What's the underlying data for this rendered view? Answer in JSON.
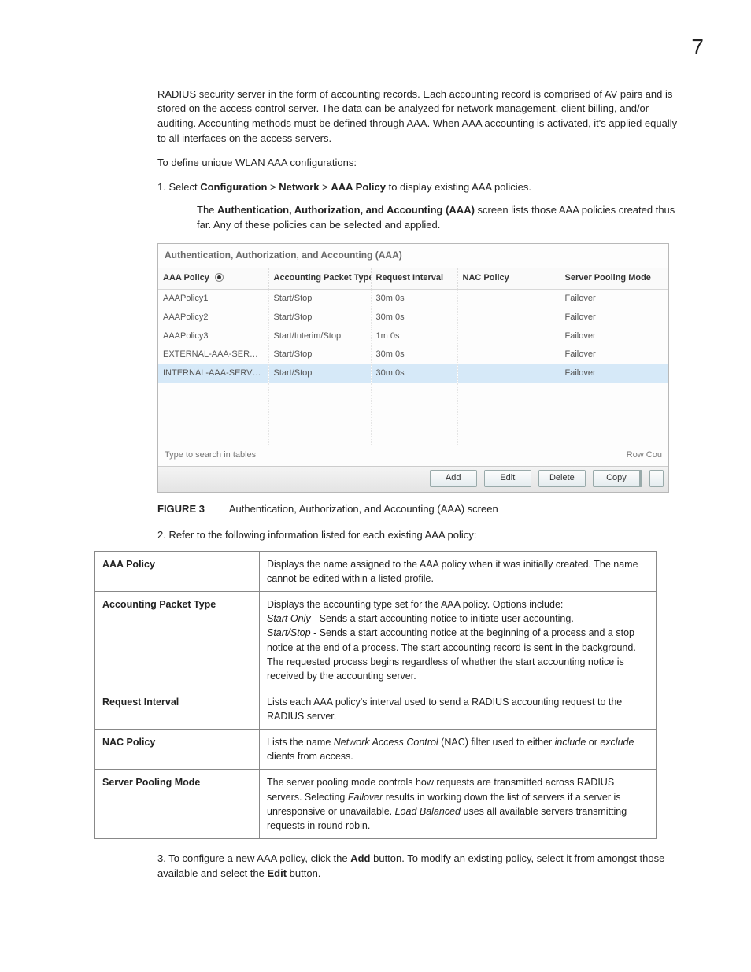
{
  "page_number": "7",
  "intro_para": "RADIUS security server in the form of accounting records. Each accounting record is comprised of AV pairs and is stored on the access control server. The data can be analyzed for network management, client billing, and/or auditing. Accounting methods must be defined through AAA. When AAA accounting is activated, it's applied equally to all interfaces on the access servers.",
  "define_line": "To define unique WLAN AAA configurations:",
  "step1_prefix": "1.   Select ",
  "step1_conf": "Configuration",
  "step1_gt1": " > ",
  "step1_net": "Network",
  "step1_gt2": " > ",
  "step1_aaa": "AAA Policy",
  "step1_suffix": " to display existing AAA policies.",
  "step1_sub_a": "The ",
  "step1_sub_bold": "Authentication, Authorization, and Accounting (AAA)",
  "step1_sub_b": " screen lists those AAA policies created thus far. Any of these policies can be selected and applied.",
  "shot": {
    "title": "Authentication, Authorization, and Accounting (AAA)",
    "headers": [
      "AAA Policy",
      "Accounting Packet Type",
      "Request Interval",
      "NAC Policy",
      "Server Pooling Mode"
    ],
    "rows": [
      {
        "policy": "AAAPolicy1",
        "pkt": "Start/Stop",
        "req": "30m 0s",
        "nac": "",
        "pool": "Failover",
        "selected": false
      },
      {
        "policy": "AAAPolicy2",
        "pkt": "Start/Stop",
        "req": "30m 0s",
        "nac": "",
        "pool": "Failover",
        "selected": false
      },
      {
        "policy": "AAAPolicy3",
        "pkt": "Start/Interim/Stop",
        "req": "1m 0s",
        "nac": "",
        "pool": "Failover",
        "selected": false
      },
      {
        "policy": "EXTERNAL-AAA-SERVERS",
        "pkt": "Start/Stop",
        "req": "30m 0s",
        "nac": "",
        "pool": "Failover",
        "selected": false
      },
      {
        "policy": "INTERNAL-AAA-SERVER",
        "pkt": "Start/Stop",
        "req": "30m 0s",
        "nac": "",
        "pool": "Failover",
        "selected": true
      }
    ],
    "search_placeholder": "Type to search in tables",
    "row_count_label": "Row Cou",
    "buttons": {
      "add": "Add",
      "edit": "Edit",
      "delete": "Delete",
      "copy": "Copy"
    }
  },
  "figure": {
    "label": "FIGURE 3",
    "caption": "Authentication, Authorization, and Accounting (AAA) screen"
  },
  "step2": "2.   Refer to the following information listed for each existing AAA policy:",
  "defs": [
    {
      "term": "AAA Policy",
      "desc_parts": [
        {
          "t": "Displays the name assigned to the AAA policy when it was initially created. The name cannot be edited within a listed profile."
        }
      ]
    },
    {
      "term": "Accounting Packet Type",
      "desc_parts": [
        {
          "t": "Displays the accounting type set for the AAA policy. Options include:"
        },
        {
          "br": true
        },
        {
          "t": "Start Only",
          "i": true
        },
        {
          "t": " - Sends a start accounting notice to initiate user accounting."
        },
        {
          "br": true
        },
        {
          "t": "Start/Stop",
          "i": true
        },
        {
          "t": " - Sends a start accounting notice at the beginning of a process and a stop notice at the end of a process. The start accounting record is sent in the background. The requested process begins regardless of whether the start accounting notice is received by the accounting server."
        }
      ]
    },
    {
      "term": "Request Interval",
      "desc_parts": [
        {
          "t": "Lists each AAA policy's interval used to send a RADIUS accounting request to the RADIUS server."
        }
      ]
    },
    {
      "term": "NAC Policy",
      "desc_parts": [
        {
          "t": "Lists the name "
        },
        {
          "t": "Network Access Control",
          "i": true
        },
        {
          "t": " (NAC) filter used to either "
        },
        {
          "t": "include",
          "i": true
        },
        {
          "t": " or "
        },
        {
          "t": "exclude",
          "i": true
        },
        {
          "t": " clients from access."
        }
      ]
    },
    {
      "term": "Server Pooling Mode",
      "desc_parts": [
        {
          "t": "The server pooling mode controls how requests are transmitted across RADIUS servers. Selecting "
        },
        {
          "t": "Failover",
          "i": true
        },
        {
          "t": " results in working down the list of servers if a server is unresponsive or unavailable. "
        },
        {
          "t": "Load Balanced",
          "i": true
        },
        {
          "t": " uses all available servers transmitting requests in round robin."
        }
      ]
    }
  ],
  "step3_a": "3.   To configure a new AAA policy, click the ",
  "step3_add": "Add",
  "step3_b": " button. To modify an existing policy, select it from amongst those available and select the ",
  "step3_edit": "Edit",
  "step3_c": " button."
}
